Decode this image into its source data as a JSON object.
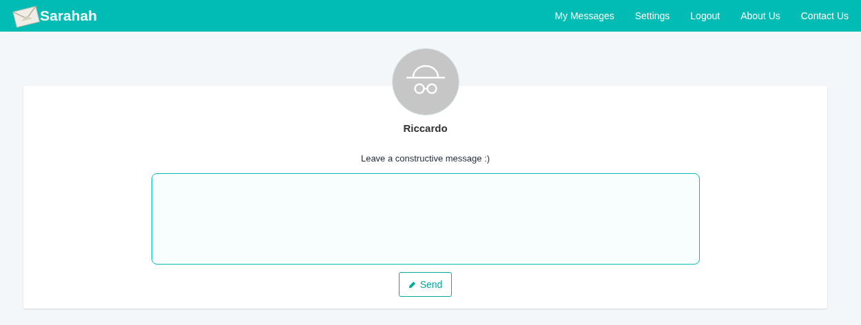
{
  "navbar": {
    "brand": "Sarahah",
    "links": [
      "My Messages",
      "Settings",
      "Logout",
      "About Us",
      "Contact Us"
    ]
  },
  "profile": {
    "name": "Riccardo"
  },
  "message_form": {
    "prompt": "Leave a constructive message :)",
    "send_button": "Send"
  }
}
